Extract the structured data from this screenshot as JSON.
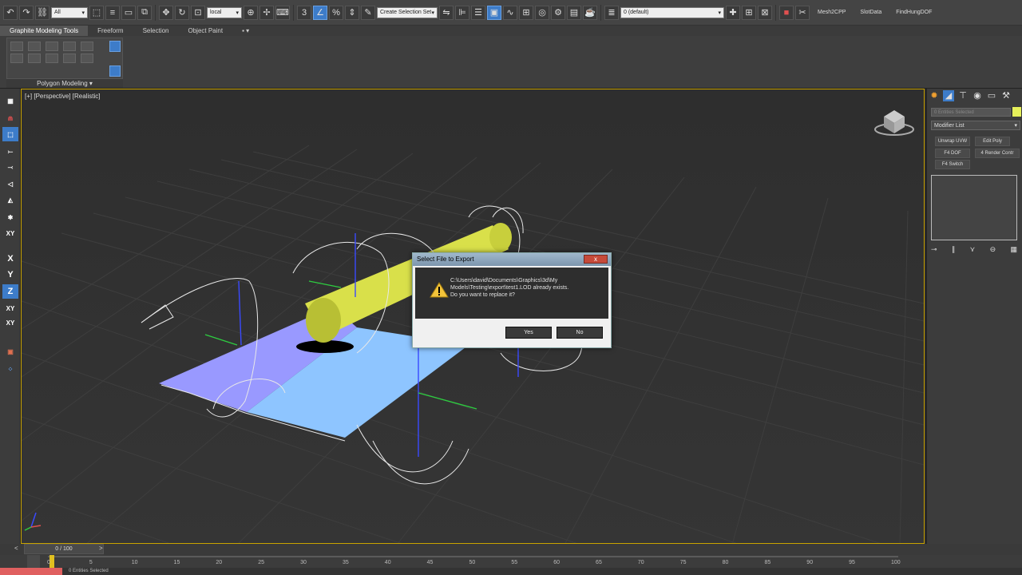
{
  "toolbar": {
    "filter_value": "All",
    "coord_system": "local",
    "selection_set": "Create Selection Set",
    "layer": "0 (default)",
    "scripts": [
      "Mesh2CPP",
      "SlotData",
      "FindHungDOF"
    ]
  },
  "ribbon": {
    "tabs": [
      "Graphite Modeling Tools",
      "Freeform",
      "Selection",
      "Object Paint"
    ],
    "panel_label": "Polygon Modeling"
  },
  "left_bar": {
    "axis_labels": [
      "X",
      "Y",
      "Z",
      "XY",
      "XY"
    ]
  },
  "viewport": {
    "label": "[+] [Perspective] [Realistic]"
  },
  "dialog": {
    "title": "Select File to Export",
    "message_line1": "C:\\Users\\david\\Documents\\Graphics\\3d\\My",
    "message_line2": "Models\\Testing\\export\\test1.LOD  already exists.",
    "message_line3": "Do you want to replace it?",
    "yes_label": "Yes",
    "no_label": "No",
    "close_label": "x"
  },
  "right_panel": {
    "selected_text": "0 Entities Selected",
    "modifier_list": "Modifier List",
    "buttons": [
      "Unwrap UVW",
      "Edit Poly",
      "F4 DOF",
      "4 Render Contr",
      "F4 Switch"
    ],
    "swatch_color": "#e6f05a"
  },
  "timeline": {
    "slider_text": "0 / 100",
    "ticks": [
      "0",
      "5",
      "10",
      "15",
      "20",
      "25",
      "30",
      "35",
      "40",
      "45",
      "50",
      "55",
      "60",
      "65",
      "70",
      "75",
      "80",
      "85",
      "90",
      "95",
      "100"
    ]
  },
  "status": {
    "text": "0 Entities Selected"
  },
  "colors": {
    "viewport_border": "#c9a300",
    "active_blue": "#3d7cc9",
    "cylinder": "#d9e04a",
    "plane_left": "#9999ff",
    "plane_right": "#8ec5ff"
  }
}
